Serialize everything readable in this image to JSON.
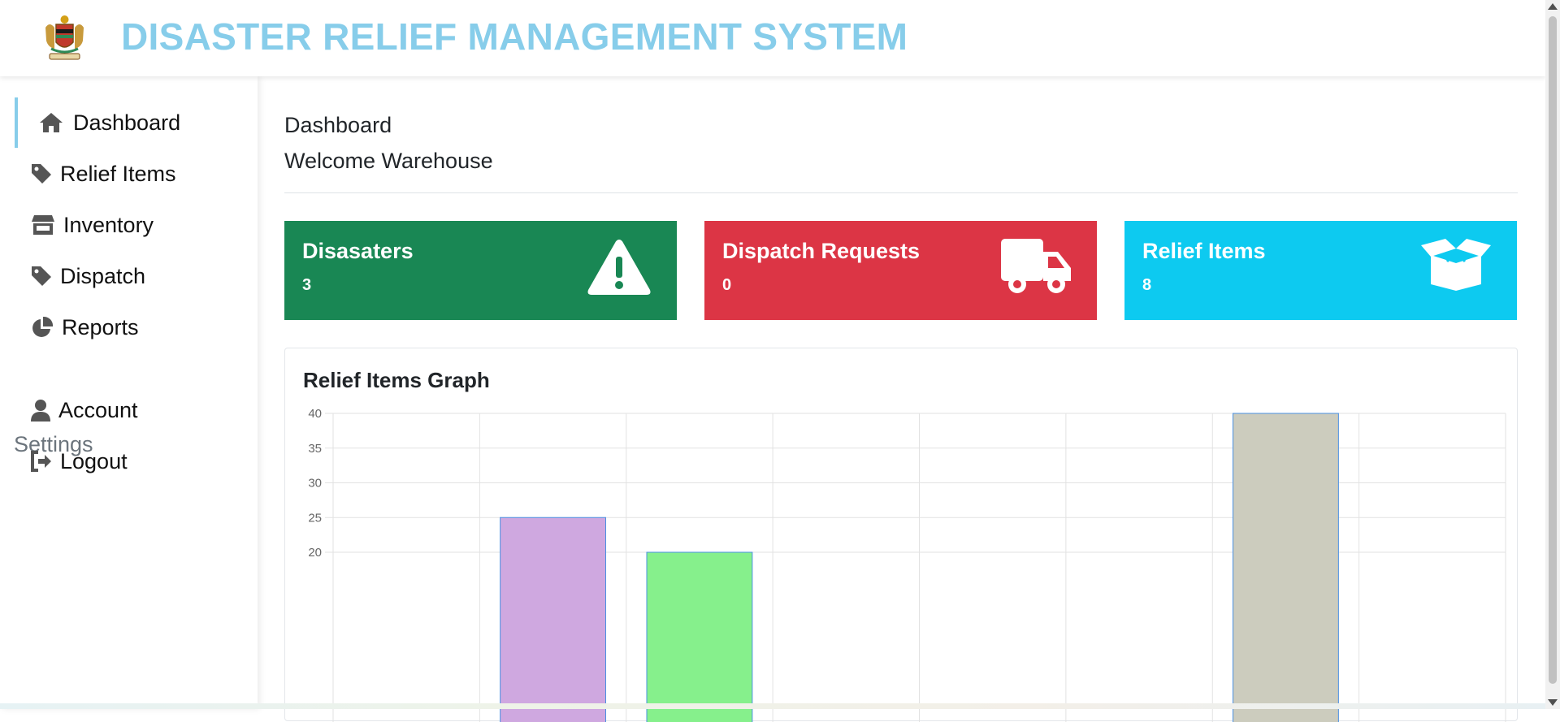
{
  "header": {
    "title": "DISASTER RELIEF MANAGEMENT SYSTEM",
    "logo_icon": "coat-of-arms-logo"
  },
  "sidebar": {
    "items": [
      {
        "label": "Dashboard",
        "icon": "home-icon",
        "active": true
      },
      {
        "label": "Relief Items",
        "icon": "tag-icon"
      },
      {
        "label": "Inventory",
        "icon": "store-icon"
      },
      {
        "label": "Dispatch",
        "icon": "tag-icon"
      },
      {
        "label": "Reports",
        "icon": "pie-chart-icon"
      }
    ],
    "settings_heading": "Settings",
    "settings_items": [
      {
        "label": "Account",
        "icon": "user-icon"
      },
      {
        "label": "Logout",
        "icon": "sign-out-icon"
      }
    ]
  },
  "main": {
    "page_title": "Dashboard",
    "welcome": "Welcome Warehouse",
    "cards": [
      {
        "title": "Disasaters",
        "value": "3",
        "color": "#198754",
        "icon": "warning-triangle-icon"
      },
      {
        "title": "Dispatch Requests",
        "value": "0",
        "color": "#dc3545",
        "icon": "truck-icon"
      },
      {
        "title": "Relief Items",
        "value": "8",
        "color": "#0dcaf0",
        "icon": "open-box-icon"
      }
    ],
    "graph": {
      "title": "Relief Items Graph"
    }
  },
  "chart_data": {
    "type": "bar",
    "title": "Relief Items Graph",
    "category_count": 8,
    "values": [
      null,
      25,
      20,
      null,
      null,
      null,
      40,
      null
    ],
    "colors": [
      null,
      "#cfa8e0",
      "#86f08c",
      null,
      null,
      null,
      "#ccccbe",
      null
    ],
    "bar_border": "#4a90e2",
    "yticks": [
      20,
      25,
      30,
      35,
      40
    ],
    "ylim_visible": [
      20,
      40
    ],
    "grid": true
  }
}
